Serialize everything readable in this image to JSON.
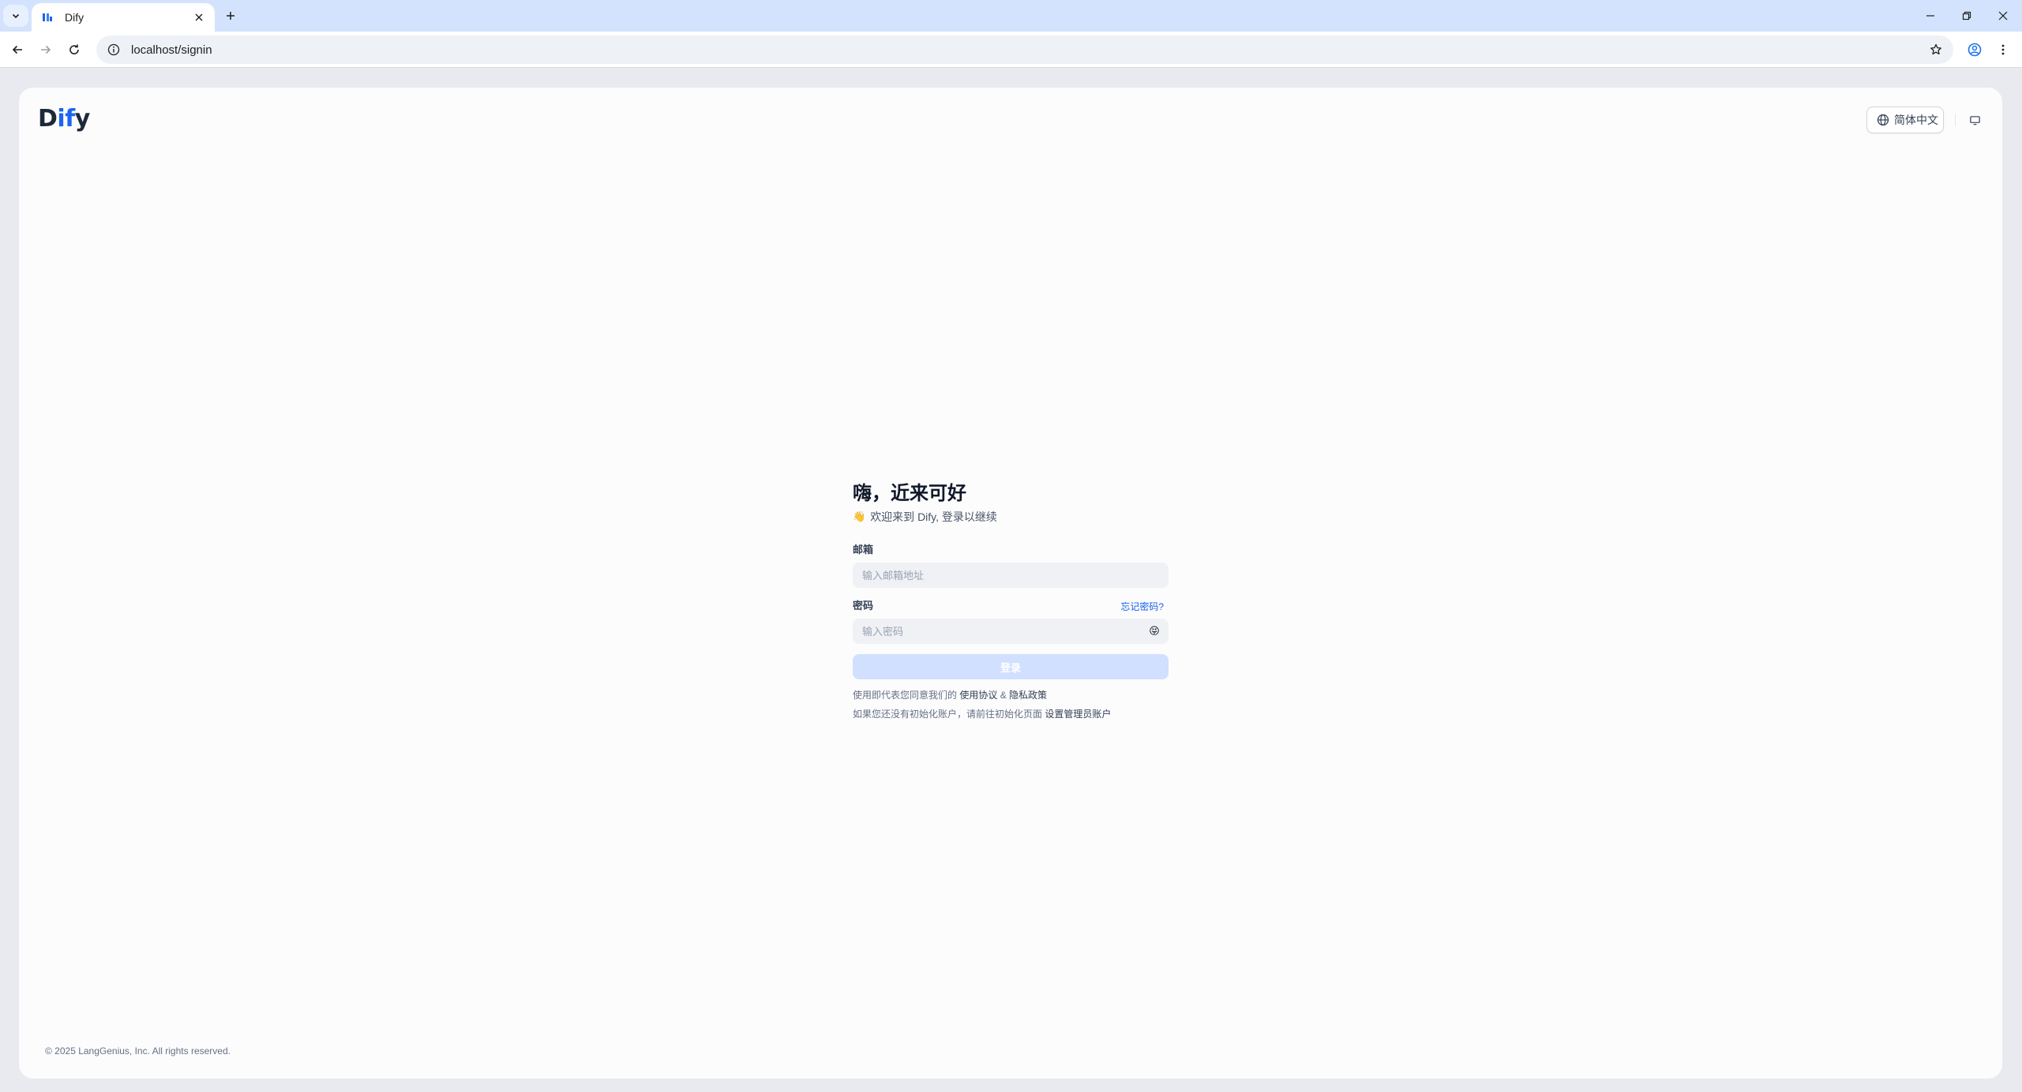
{
  "browser": {
    "tab_title": "Dify",
    "tab_favicon": "dify-favicon-icon",
    "url": "localhost/signin"
  },
  "header": {
    "logo_prefix": "D",
    "logo_highlight": "if",
    "logo_suffix": "y",
    "language": "简体中文"
  },
  "signin": {
    "title": "嗨，近来可好",
    "subtitle_emoji": "👋",
    "subtitle": "欢迎来到 Dify, 登录以继续",
    "email_label": "邮箱",
    "email_placeholder": "输入邮箱地址",
    "email_value": "",
    "password_label": "密码",
    "forgot_password": "忘记密码?",
    "password_placeholder": "输入密码",
    "password_value": "",
    "submit_label": "登录",
    "terms_prefix": "使用即代表您同意我们的 ",
    "terms_of_service": "使用协议",
    "terms_and": " & ",
    "privacy_policy": "隐私政策",
    "setup_prefix": "如果您还没有初始化账户，请前往初始化页面 ",
    "setup_link": "设置管理员账户"
  },
  "footer": {
    "copyright": "© 2025 LangGenius, Inc. All rights reserved."
  },
  "colors": {
    "accent": "#1c64f2",
    "submit_disabled": "#d1e0ff",
    "link": "#155eef",
    "page_bg": "#fcfcfd"
  }
}
